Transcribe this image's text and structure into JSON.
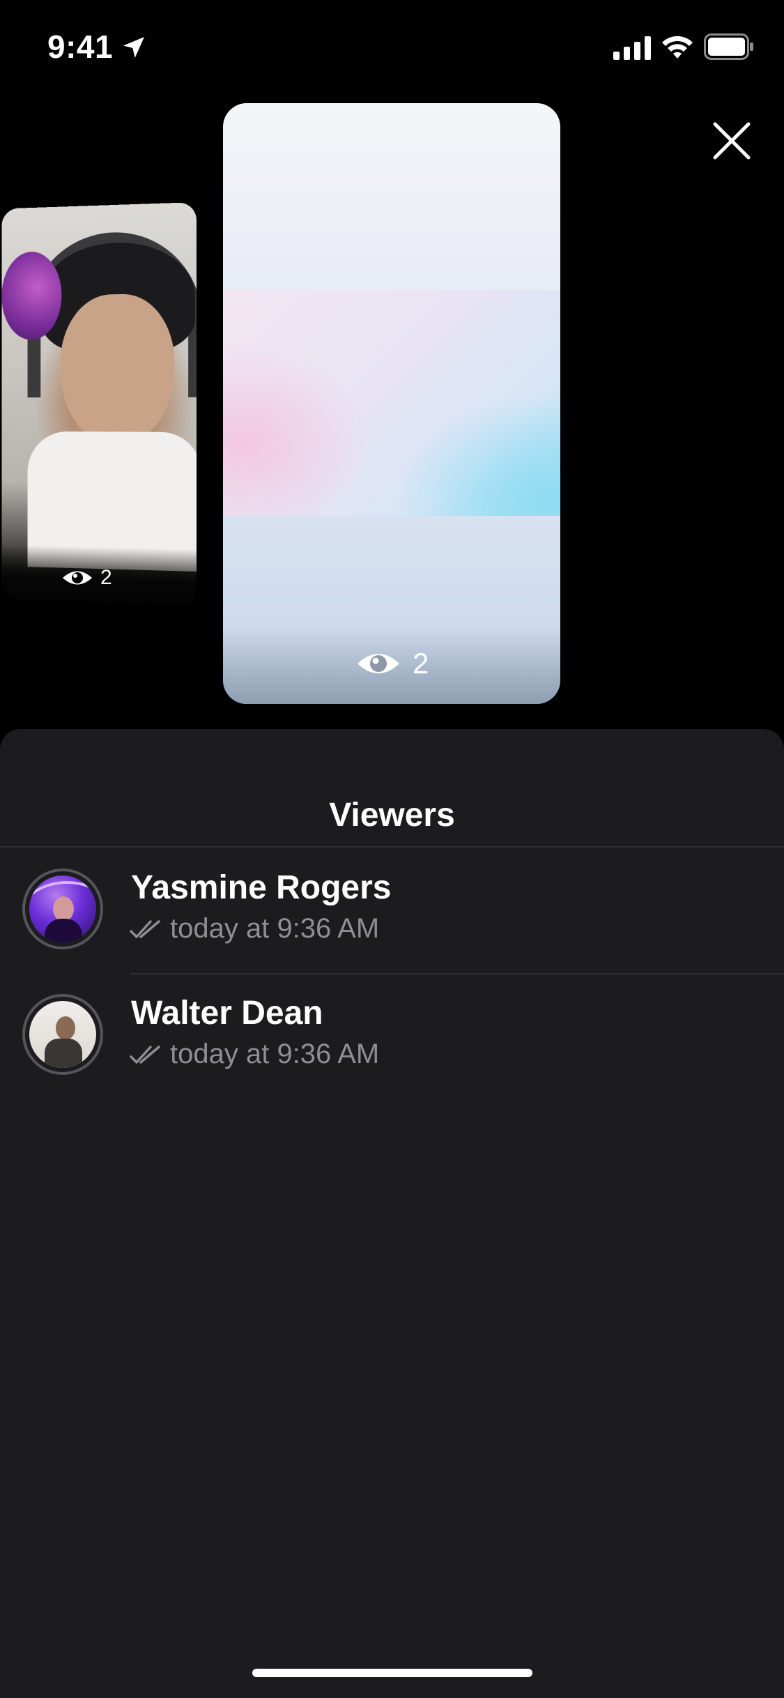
{
  "status_bar": {
    "time": "9:41",
    "icons": [
      "location-icon",
      "signal-icon",
      "wifi-icon",
      "battery-icon"
    ]
  },
  "close": {
    "icon": "close-icon"
  },
  "stories": {
    "previous": {
      "views": "2"
    },
    "current": {
      "views": "2"
    }
  },
  "sheet": {
    "title": "Viewers",
    "viewers": [
      {
        "name": "Yasmine Rogers",
        "time": "today at 9:36 AM",
        "status_icon": "double-check-icon"
      },
      {
        "name": "Walter Dean",
        "time": "today at 9:36 AM",
        "status_icon": "double-check-icon"
      }
    ]
  },
  "colors": {
    "background": "#000000",
    "sheet": "#1c1c1e",
    "secondary_text": "#8e8e93"
  }
}
